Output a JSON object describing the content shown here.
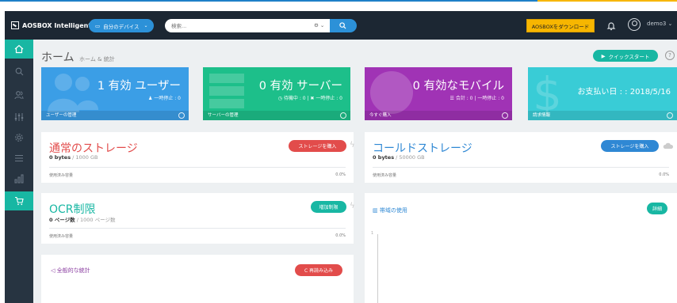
{
  "app": {
    "logo": "AOSBOX Intelligent",
    "device_button": "自分のデバイス",
    "search_placeholder": "検索...",
    "download_button": "AOSBOXをダウンロード",
    "username": "demo3"
  },
  "page": {
    "title": "ホーム",
    "subtitle": "ホーム & 統計",
    "quick_start": "クイックスタート",
    "help": "?"
  },
  "stats": {
    "users": {
      "main": "1 有効 ユーザー",
      "side": "一時停止 : 0",
      "foot": "ユーザーの管理"
    },
    "servers": {
      "main": "0 有効 サーバー",
      "side": "待機中 : 0  |  ✖ 一時停止 : 0",
      "foot": "サーバーの管理"
    },
    "mobiles": {
      "main": "0 有効なモバイル",
      "side": "合計 : 0  |  一時停止 : 0",
      "foot": "今すぐ購入"
    },
    "payment": {
      "main": "お支払い日 : : 2018/5/16",
      "foot": "請求情報"
    }
  },
  "cards": {
    "normal_storage": {
      "title": "通常のストレージ",
      "used": "0 bytes",
      "total": " / 1000 GB",
      "button": "ストレージを購入",
      "usage_label": "使用済み容量",
      "usage_value": "0.0%"
    },
    "cold_storage": {
      "title": "コールドストレージ",
      "used": "0 bytes",
      "total": " / 50000 GB",
      "button": "ストレージを購入",
      "usage_label": "使用済み容量",
      "usage_value": "0.0%"
    },
    "ocr": {
      "title": "OCR制限",
      "used": "0 ページ数",
      "total": " / 1000 ページ数",
      "button": "増加制限",
      "usage_label": "使用済み容量",
      "usage_value": "0.0%"
    },
    "bandwidth": {
      "title": "帯域の使用",
      "button": "詳細",
      "axis_label": "1"
    },
    "general_stats": {
      "title": "全般的な統計",
      "button": "C 再読み込み"
    }
  },
  "colors": {
    "accent": "#2c91d8",
    "teal": "#18b7a3",
    "red": "#e24c4b",
    "purple": "#a033b5",
    "yellow": "#f7b600"
  }
}
